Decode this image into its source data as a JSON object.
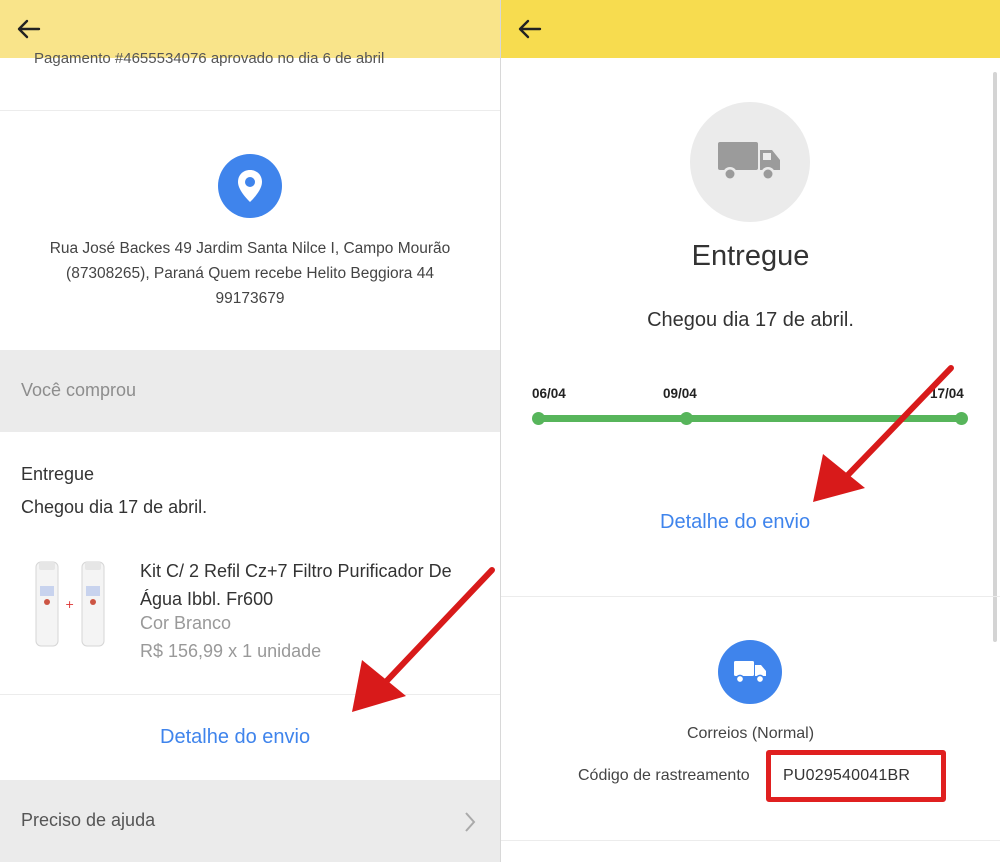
{
  "left": {
    "payment_line": "Pagamento #4655534076 aprovado no dia 6 de abril",
    "address": "Rua José Backes 49 Jardim Santa Nilce I, Campo Mourão (87308265), Paraná Quem recebe Helito Beggiora 44 99173679",
    "purchased_header": "Você comprou",
    "shipment_status": "Entregue",
    "shipment_arrival": "Chegou dia 17 de abril.",
    "product": {
      "title": "Kit C/ 2 Refil Cz+7 Filtro Purificador De Água Ibbl. Fr600",
      "color": "Cor Branco",
      "price": "R$ 156,99 x 1 unidade"
    },
    "shipment_detail_link": "Detalhe do envio",
    "help_label": "Preciso de ajuda"
  },
  "right": {
    "status_title": "Entregue",
    "status_sub": "Chegou dia 17 de abril.",
    "timeline": {
      "dates": [
        "06/04",
        "09/04",
        "17/04"
      ],
      "progress": 1.0,
      "color": "#57b55b"
    },
    "shipment_detail_link": "Detalhe do envio",
    "carrier": "Correios (Normal)",
    "tracking_label": "Código de rastreamento",
    "tracking_code": "PU029540041BR"
  },
  "colors": {
    "topbar_left": "#f9e48a",
    "topbar_right": "#f7dc4f",
    "accent_blue": "#3f84ec",
    "annotation_red": "#e02020"
  },
  "icons": {
    "back": "arrow-left-icon",
    "location": "location-pin-icon",
    "delivery": "truck-icon",
    "carrier": "truck-icon",
    "help": "chevron-right-icon"
  }
}
